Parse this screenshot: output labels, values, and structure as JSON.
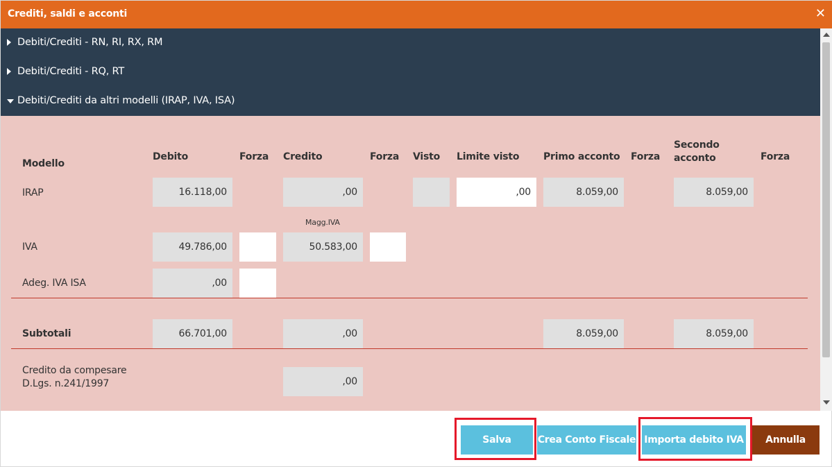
{
  "dialog": {
    "title": "Crediti, saldi e acconti",
    "close_glyph": "✕"
  },
  "sections": [
    {
      "label": "Debiti/Crediti - RN, RI, RX, RM",
      "expanded": false
    },
    {
      "label": "Debiti/Crediti - RQ, RT",
      "expanded": false
    },
    {
      "label": "Debiti/Crediti da altri modelli (IRAP, IVA, ISA)",
      "expanded": true
    }
  ],
  "table": {
    "headers": {
      "modello": "Modello",
      "debito": "Debito",
      "forza1": "Forza",
      "credito": "Credito",
      "forza2": "Forza",
      "visto": "Visto",
      "limite_visto": "Limite visto",
      "primo_acconto": "Primo acconto",
      "forza3": "Forza",
      "secondo_acconto": "Secondo acconto",
      "forza4": "Forza"
    },
    "irap": {
      "label": "IRAP",
      "debito": "16.118,00",
      "credito": ",00",
      "visto": "",
      "limite_visto": ",00",
      "primo_acconto": "8.059,00",
      "secondo_acconto": "8.059,00"
    },
    "iva": {
      "label": "IVA",
      "magg_label": "Magg.IVA",
      "debito": "49.786,00",
      "forza": "",
      "credito": "50.583,00",
      "forza_credito": ""
    },
    "adeg": {
      "label": "Adeg. IVA ISA",
      "debito": ",00",
      "forza": ""
    },
    "subtotali": {
      "label": "Subtotali",
      "debito": "66.701,00",
      "credito": ",00",
      "primo_acconto": "8.059,00",
      "secondo_acconto": "8.059,00"
    },
    "credito_compensare": {
      "label_line1": "Credito da compesare",
      "label_line2": "D.Lgs. n.241/1997",
      "credito": ",00"
    }
  },
  "buttons": {
    "salva": "Salva",
    "crea_conto": "Crea Conto Fiscale",
    "importa": "Importa debito IVA",
    "annulla": "Annulla"
  },
  "colors": {
    "titlebar": "#e2691e",
    "section_header": "#2c3e50",
    "panel": "#ecc7c2",
    "button_primary": "#5bc0de",
    "button_cancel": "#8b3a0e",
    "highlight": "#e5192a"
  }
}
